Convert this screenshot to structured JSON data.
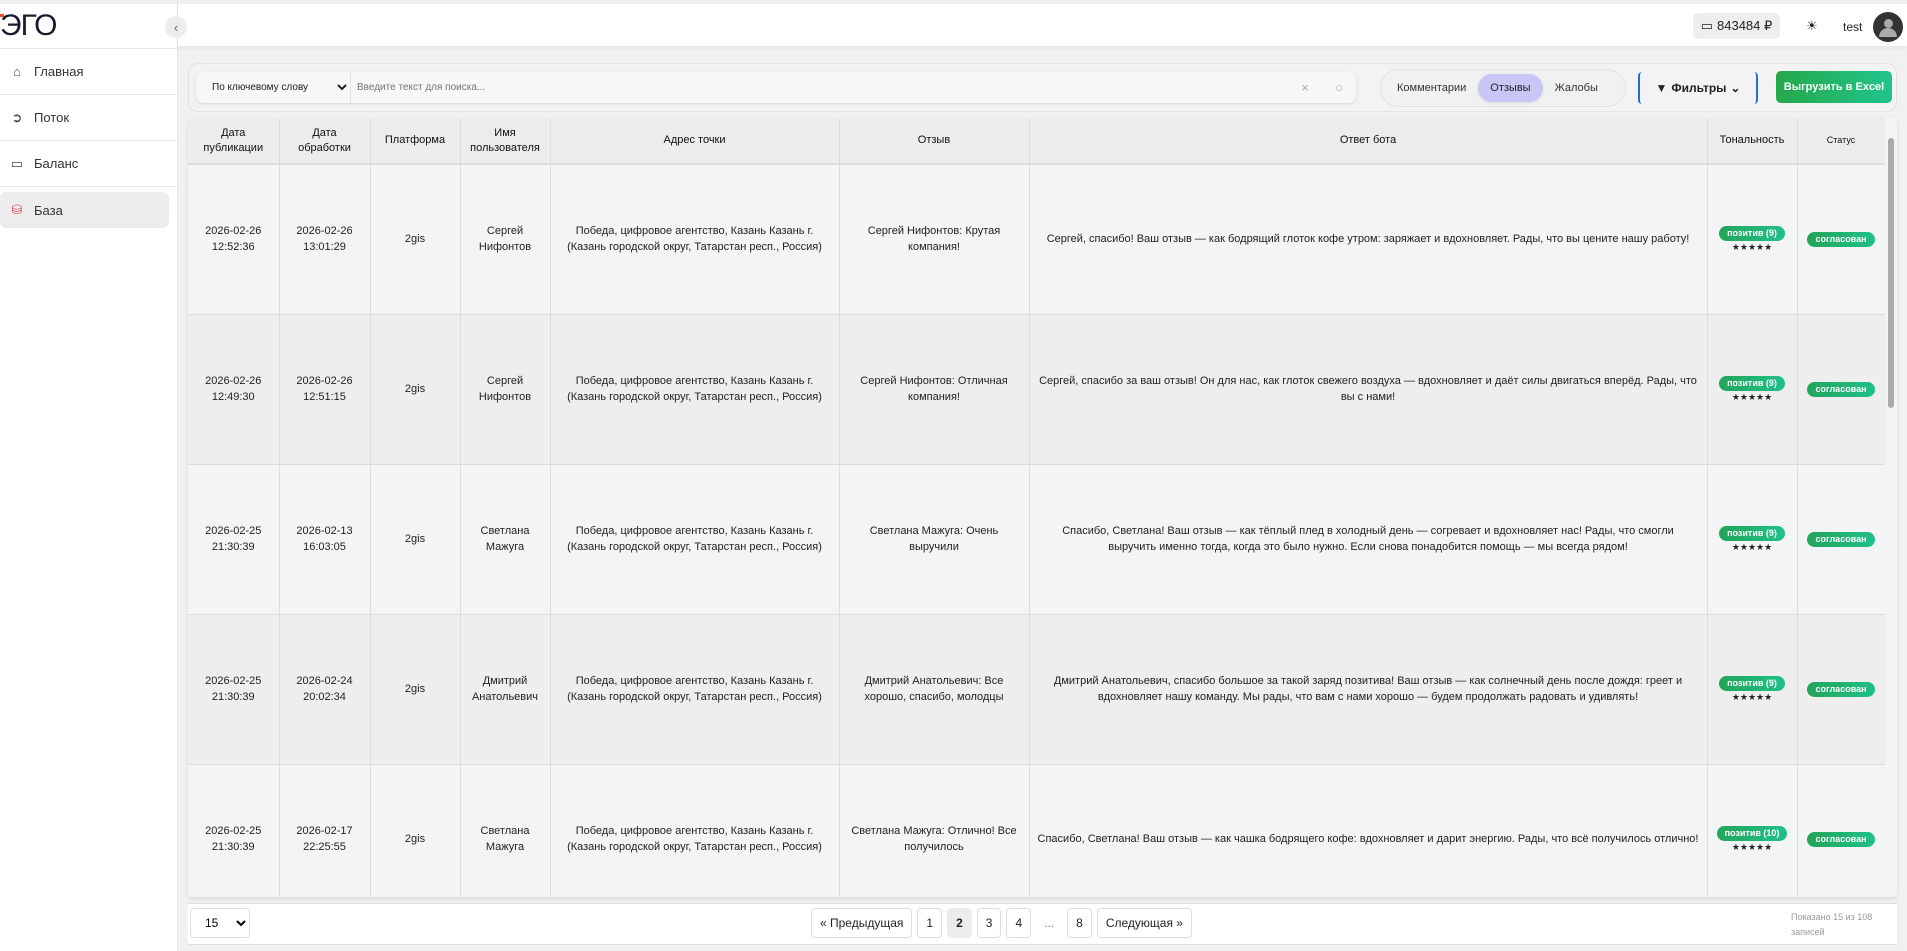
{
  "sidebar": {
    "logo": "ЭГО",
    "items": [
      {
        "label": "Главная",
        "icon": "home-icon"
      },
      {
        "label": "Поток",
        "icon": "arrow-circle-icon"
      },
      {
        "label": "Баланс",
        "icon": "wallet-icon"
      },
      {
        "label": "База",
        "icon": "database-icon"
      }
    ],
    "active": "База"
  },
  "header": {
    "balance": "843484 ₽",
    "user": "test"
  },
  "toolbar": {
    "search_mode": "По ключевому слову",
    "search_placeholder": "Введите текст для поиска...",
    "tabs": [
      "Комментарии",
      "Отзывы",
      "Жалобы"
    ],
    "active_tab": "Отзывы",
    "filters": "Фильтры",
    "export": "Выгрузить в Excel"
  },
  "table": {
    "columns": [
      "Дата публикации",
      "Дата обработки",
      "Платформа",
      "Имя пользователя",
      "Адрес точки",
      "Отзыв",
      "Ответ бота",
      "Тональность",
      "Статус"
    ],
    "rows": [
      {
        "pub": "2026-02-26 12:52:36",
        "proc": "2026-02-26 13:01:29",
        "platform": "2gis",
        "user": "Сергей Нифонтов",
        "address": "Победа, цифровое агентство, Казань Казань г. (Казань городской округ, Татарстан респ., Россия)",
        "review": "Сергей Нифонтов: Крутая компания!",
        "reply": "Сергей, спасибо! Ваш отзыв — как бодрящий глоток кофе утром: заряжает и вдохновляет. Рады, что вы цените нашу работу!",
        "tone": "позитив (9)",
        "stars": "★★★★★",
        "status": "согласован"
      },
      {
        "pub": "2026-02-26 12:49:30",
        "proc": "2026-02-26 12:51:15",
        "platform": "2gis",
        "user": "Сергей Нифонтов",
        "address": "Победа, цифровое агентство, Казань Казань г. (Казань городской округ, Татарстан респ., Россия)",
        "review": "Сергей Нифонтов: Отличная компания!",
        "reply": "Сергей, спасибо за ваш отзыв! Он для нас, как глоток свежего воздуха — вдохновляет и даёт силы двигаться вперёд. Рады, что вы с нами!",
        "tone": "позитив (9)",
        "stars": "★★★★★",
        "status": "согласован"
      },
      {
        "pub": "2026-02-25 21:30:39",
        "proc": "2026-02-13 16:03:05",
        "platform": "2gis",
        "user": "Светлана Мажуга",
        "address": "Победа, цифровое агентство, Казань Казань г. (Казань городской округ, Татарстан респ., Россия)",
        "review": "Светлана Мажуга: Очень выручили",
        "reply": "Спасибо, Светлана! Ваш отзыв — как тёплый плед в холодный день — согревает и вдохновляет нас! Рады, что смогли выручить именно тогда, когда это было нужно. Если снова понадобится помощь — мы всегда рядом!",
        "tone": "позитив (9)",
        "stars": "★★★★★",
        "status": "согласован"
      },
      {
        "pub": "2026-02-25 21:30:39",
        "proc": "2026-02-24 20:02:34",
        "platform": "2gis",
        "user": "Дмитрий Анатольевич",
        "address": "Победа, цифровое агентство, Казань Казань г. (Казань городской округ, Татарстан респ., Россия)",
        "review": "Дмитрий Анатольевич: Все хорошо, спасибо, молодцы",
        "reply": "Дмитрий Анатольевич, спасибо большое за такой заряд позитива! Ваш отзыв — как солнечный день после дождя: греет и вдохновляет нашу команду. Мы рады, что вам с нами хорошо — будем продолжать радовать и удивлять!",
        "tone": "позитив (9)",
        "stars": "★★★★★",
        "status": "согласован"
      },
      {
        "pub": "2026-02-25 21:30:39",
        "proc": "2026-02-17 22:25:55",
        "platform": "2gis",
        "user": "Светлана Мажуга",
        "address": "Победа, цифровое агентство, Казань Казань г. (Казань городской округ, Татарстан респ., Россия)",
        "review": "Светлана Мажуга: Отлично! Все получилось",
        "reply": "Спасибо, Светлана! Ваш отзыв — как чашка бодрящего кофе: вдохновляет и дарит энергию. Рады, что всё получилось отлично!",
        "tone": "позитив (10)",
        "stars": "★★★★★",
        "status": "согласован"
      }
    ]
  },
  "pagination": {
    "per_page": "15",
    "prev": "« Предыдущая",
    "pages": [
      "1",
      "2",
      "3",
      "4",
      "...",
      "8"
    ],
    "current": "2",
    "next": "Следующая »",
    "shown": "Показано 15 из 108 записей"
  },
  "colors": {
    "accent_green": "#22a559",
    "tab_active": "#c7c6f5",
    "filter_border": "#1f6fd6"
  }
}
